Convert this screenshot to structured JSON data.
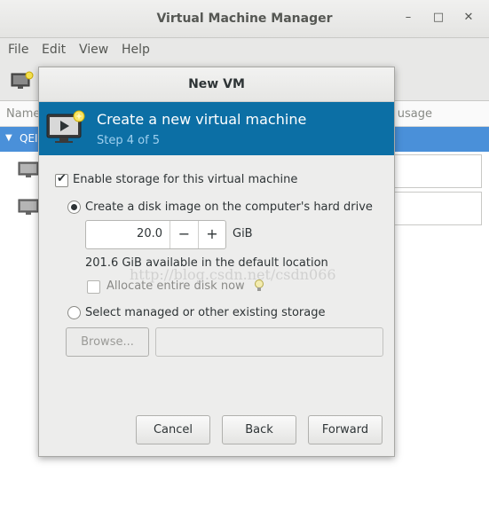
{
  "main_window": {
    "title": "Virtual Machine Manager",
    "controls": {
      "minimize": "–",
      "maximize": "□",
      "close": "✕"
    },
    "menu": [
      "File",
      "Edit",
      "View",
      "Help"
    ],
    "list": {
      "col_name": "Name",
      "col_usage": "usage",
      "connection_label": "QEI"
    }
  },
  "dialog": {
    "title": "New VM",
    "banner": {
      "heading": "Create a new virtual machine",
      "step": "Step 4 of 5"
    },
    "enable_storage": {
      "label": "Enable storage for this virtual machine",
      "checked": true
    },
    "create_disk": {
      "label": "Create a disk image on the computer's hard drive",
      "selected": true
    },
    "disk_size": {
      "value": "20.0",
      "unit": "GiB",
      "minus": "−",
      "plus": "+"
    },
    "available": "201.6 GiB available in the default location",
    "allocate": {
      "label": "Allocate entire disk now",
      "checked": false
    },
    "managed": {
      "label": "Select managed or other existing storage",
      "selected": false
    },
    "browse_button": "Browse...",
    "buttons": {
      "cancel": "Cancel",
      "back": "Back",
      "forward": "Forward"
    }
  },
  "watermark": "http://blog.csdn.net/csdn066",
  "colors": {
    "banner": "#0c6fa5",
    "selection": "#4a90d9"
  }
}
